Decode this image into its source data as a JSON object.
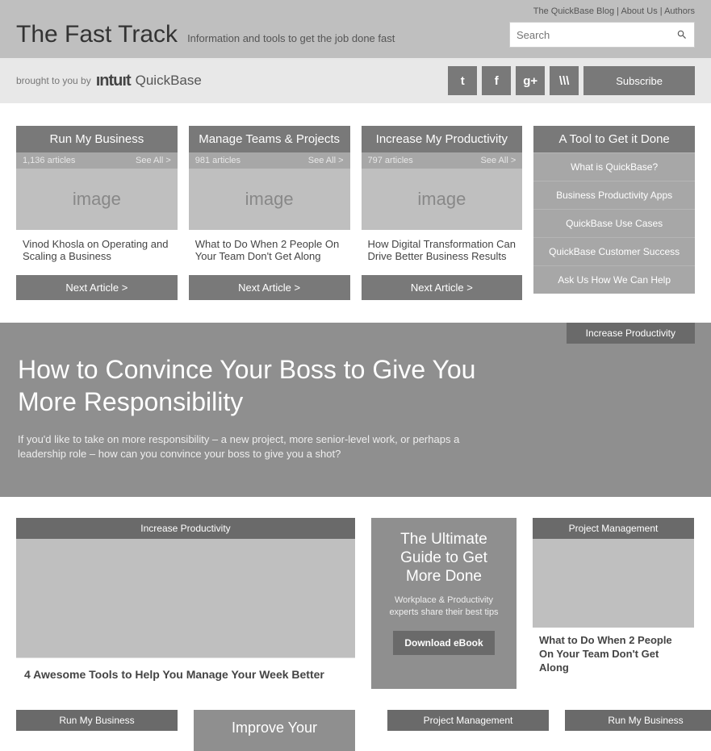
{
  "topLinks": {
    "blog": "The QuickBase Blog",
    "about": "About Us",
    "authors": "Authors",
    "sep": "  |  "
  },
  "header": {
    "title": "The Fast Track",
    "tagline": "Information and tools to get the job done fast",
    "searchPlaceholder": "Search",
    "broughtBy": "brought to you by",
    "brand1": "ıntuıt",
    "brand2": "QuickBase"
  },
  "social": {
    "t": "t",
    "f": "f",
    "g": "g+",
    "m": "\\\\\\",
    "subscribe": "Subscribe"
  },
  "cats": [
    {
      "head": "Run My Business",
      "count": "1,136 articles",
      "see": "See All >",
      "img": "image",
      "title": "Vinod Khosla on Operating and Scaling a Business",
      "next": "Next Article >"
    },
    {
      "head": "Manage Teams & Projects",
      "count": "981 articles",
      "see": "See All >",
      "img": "image",
      "title": "What to Do When 2 People On Your Team Don't Get Along",
      "next": "Next Article >"
    },
    {
      "head": "Increase My Productivity",
      "count": "797 articles",
      "see": "See All >",
      "img": "image",
      "title": "How Digital Transformation Can Drive Better Business Results",
      "next": "Next Article >"
    }
  ],
  "tool": {
    "head": "A Tool to Get it Done",
    "items": [
      "What is QuickBase?",
      "Business Productivity Apps",
      "QuickBase Use Cases",
      "QuickBase Customer Success",
      "Ask Us How We Can Help"
    ]
  },
  "hero": {
    "tag": "Increase Productivity",
    "title": "How to Convince Your Boss to Give You More Responsibility",
    "body": "If you'd like to take on more responsibility – a new project, more senior-level work, or perhaps a leadership role – how can you convince your boss to give you a shot?"
  },
  "grid": {
    "left": {
      "tag": "Increase Productivity",
      "title": "4 Awesome Tools to Help You Manage Your Week Better"
    },
    "promo": {
      "title": "The Ultimate Guide to Get More Done",
      "body": "Workplace & Productivity experts share their best tips",
      "btn": "Download eBook"
    },
    "right": {
      "tag": "Project Management",
      "title": "What to Do When 2 People On Your Team Don't Get Along"
    }
  },
  "bottom": {
    "a": "Run My Business",
    "b": "Improve Your",
    "c": "Project Management",
    "d": "Run My Business"
  }
}
